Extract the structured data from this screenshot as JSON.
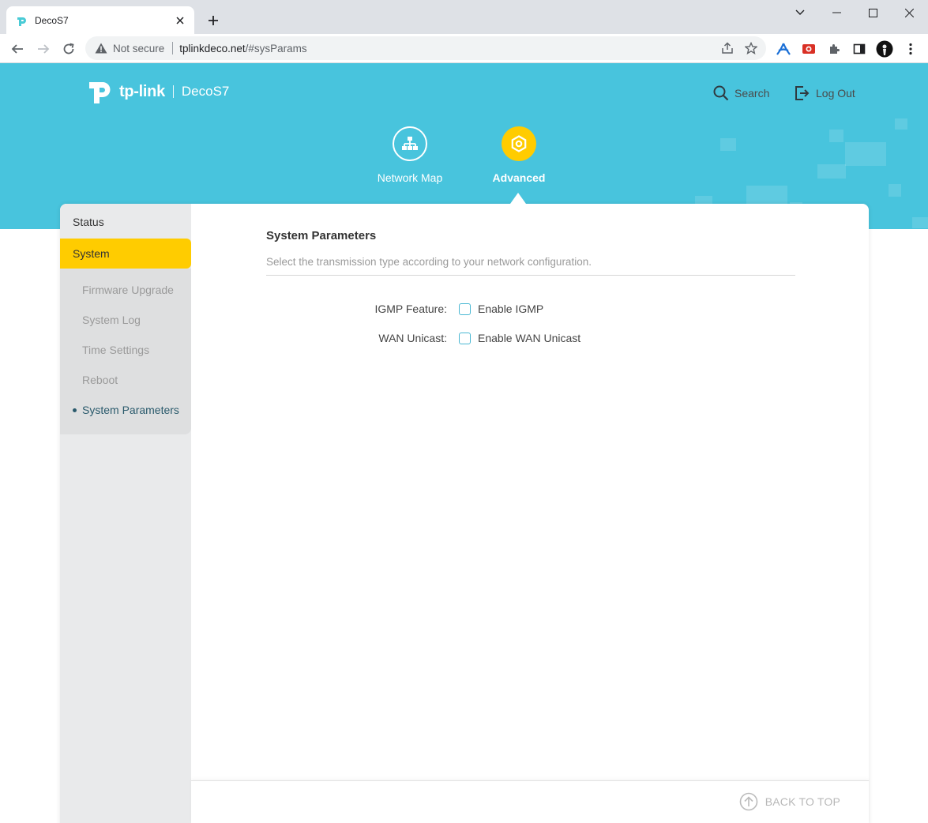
{
  "browser": {
    "tab_title": "DecoS7",
    "security_label": "Not secure",
    "url_host": "tplinkdeco.net",
    "url_path": "/#sysParams"
  },
  "header": {
    "brand": "tp-link",
    "model": "DecoS7",
    "search_label": "Search",
    "logout_label": "Log Out"
  },
  "main_nav": [
    {
      "label": "Network Map",
      "icon": "network-map-icon",
      "active": false
    },
    {
      "label": "Advanced",
      "icon": "advanced-gear-icon",
      "active": true
    }
  ],
  "sidebar": {
    "items": [
      {
        "label": "Status"
      },
      {
        "label": "System",
        "active": true
      }
    ],
    "subitems": [
      {
        "label": "Firmware Upgrade"
      },
      {
        "label": "System Log"
      },
      {
        "label": "Time Settings"
      },
      {
        "label": "Reboot"
      },
      {
        "label": "System Parameters",
        "current": true
      }
    ]
  },
  "content": {
    "title": "System Parameters",
    "description": "Select the transmission type according to your network configuration.",
    "fields": [
      {
        "label": "IGMP Feature:",
        "checkbox_label": "Enable IGMP",
        "checked": false
      },
      {
        "label": "WAN Unicast:",
        "checkbox_label": "Enable WAN Unicast",
        "checked": false
      }
    ]
  },
  "footer": {
    "back_to_top": "BACK TO TOP"
  },
  "colors": {
    "banner": "#48c4dd",
    "accent_yellow": "#ffcc00",
    "checkbox_border": "#4ab8d3"
  }
}
